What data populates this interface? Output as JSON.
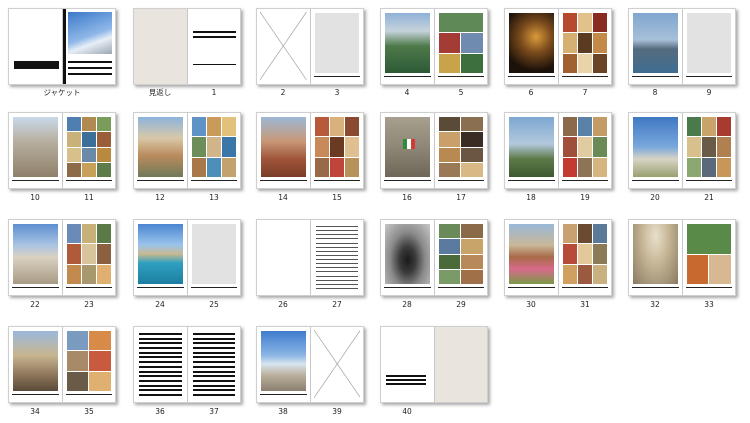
{
  "labels": {
    "jacket": "ジャケット",
    "endpaper": "見返し",
    "p1": "1",
    "p2": "2",
    "p3": "3",
    "p4": "4",
    "p5": "5",
    "p6": "6",
    "p7": "7",
    "p8": "8",
    "p9": "9",
    "p10": "10",
    "p11": "11",
    "p12": "12",
    "p13": "13",
    "p14": "14",
    "p15": "15",
    "p16": "16",
    "p17": "17",
    "p18": "18",
    "p19": "19",
    "p20": "20",
    "p21": "21",
    "p22": "22",
    "p23": "23",
    "p24": "24",
    "p25": "25",
    "p26": "26",
    "p27": "27",
    "p28": "28",
    "p29": "29",
    "p30": "30",
    "p31": "31",
    "p32": "32",
    "p33": "33",
    "p34": "34",
    "p35": "35",
    "p36": "36",
    "p37": "37",
    "p38": "38",
    "p39": "39",
    "p40": "40"
  },
  "colors": {
    "beige": "#e9e4dd",
    "sky": "#6a9fd8",
    "stone": "#b9a58a",
    "night": "#2a1d10",
    "grass": "#4f7a3a",
    "sea": "#2b8fb3",
    "gray_placeholder": "#e2e2e2"
  },
  "icons": {
    "blank_page": "x-placeholder-icon",
    "text_page": "text-lines-icon"
  }
}
